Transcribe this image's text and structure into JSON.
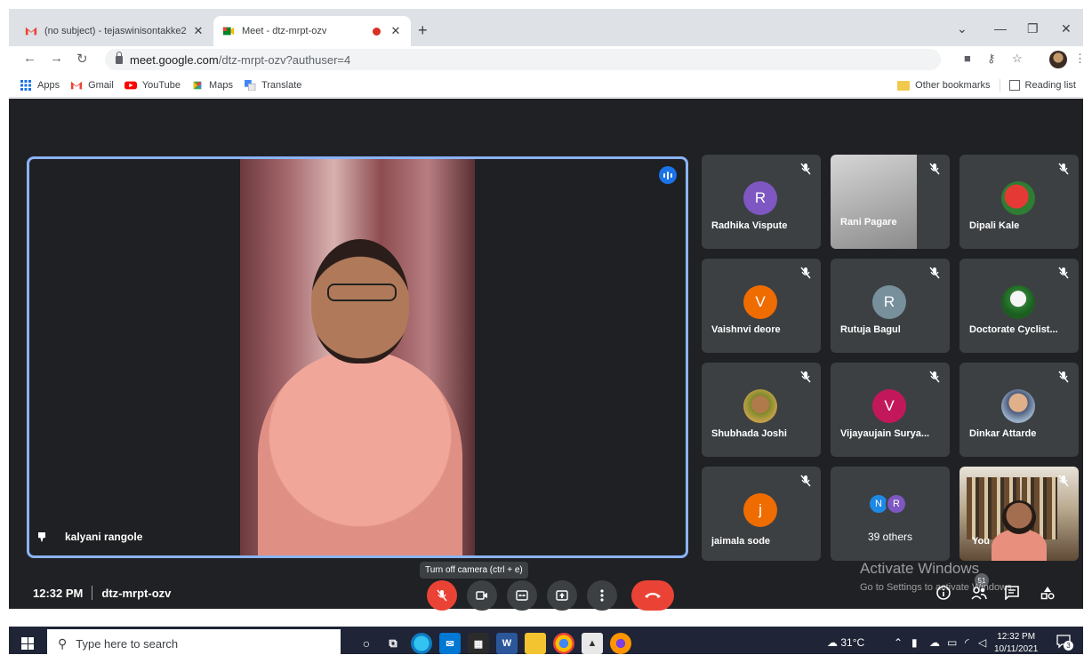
{
  "browser": {
    "tabs": [
      {
        "title": "(no subject) - tejaswinisontakke2",
        "favicon": "gmail-icon"
      },
      {
        "title": "Meet - dtz-mrpt-ozv",
        "favicon": "meet-icon",
        "recording": true
      }
    ],
    "new_tab_label": "+",
    "url_host": "meet.google.com",
    "url_path": "/dtz-mrpt-ozv?authuser=4",
    "bookmarks": [
      "Apps",
      "Gmail",
      "YouTube",
      "Maps",
      "Translate"
    ],
    "other_bookmarks": "Other bookmarks",
    "reading_list": "Reading list"
  },
  "meet": {
    "main_speaker": "kalyani rangole",
    "meeting_time": "12:32 PM",
    "meeting_code": "dtz-mrpt-ozv",
    "tooltip": "Turn off camera (ctrl + e)",
    "people_count": "51",
    "participants": [
      {
        "name": "Radhika Vispute",
        "initial": "R",
        "color": "#7e57c2"
      },
      {
        "name": "Rani Pagare",
        "initial": "",
        "color": ""
      },
      {
        "name": "Dipali Kale",
        "initial": "",
        "color": ""
      },
      {
        "name": "Vaishnvi deore",
        "initial": "V",
        "color": "#ef6c00"
      },
      {
        "name": "Rutuja Bagul",
        "initial": "R",
        "color": "#78909c"
      },
      {
        "name": "Doctorate Cyclist...",
        "initial": "",
        "color": ""
      },
      {
        "name": "Shubhada Joshi",
        "initial": "",
        "color": ""
      },
      {
        "name": "Vijayaujain Surya...",
        "initial": "V",
        "color": "#c2185b"
      },
      {
        "name": "Dinkar Attarde",
        "initial": "",
        "color": ""
      },
      {
        "name": "jaimala sode",
        "initial": "j",
        "color": "#ef6c00"
      }
    ],
    "others": {
      "label": "39 others",
      "avatars": [
        {
          "initial": "N",
          "color": "#1e88e5"
        },
        {
          "initial": "R",
          "color": "#7e57c2"
        }
      ]
    },
    "self_label": "You"
  },
  "windows_watermark": {
    "line1": "Activate Windows",
    "line2": "Go to Settings to activate Windows."
  },
  "taskbar": {
    "search_placeholder": "Type here to search",
    "temperature": "31°C",
    "time": "12:32 PM",
    "date": "10/11/2021",
    "notification_count": "3"
  }
}
